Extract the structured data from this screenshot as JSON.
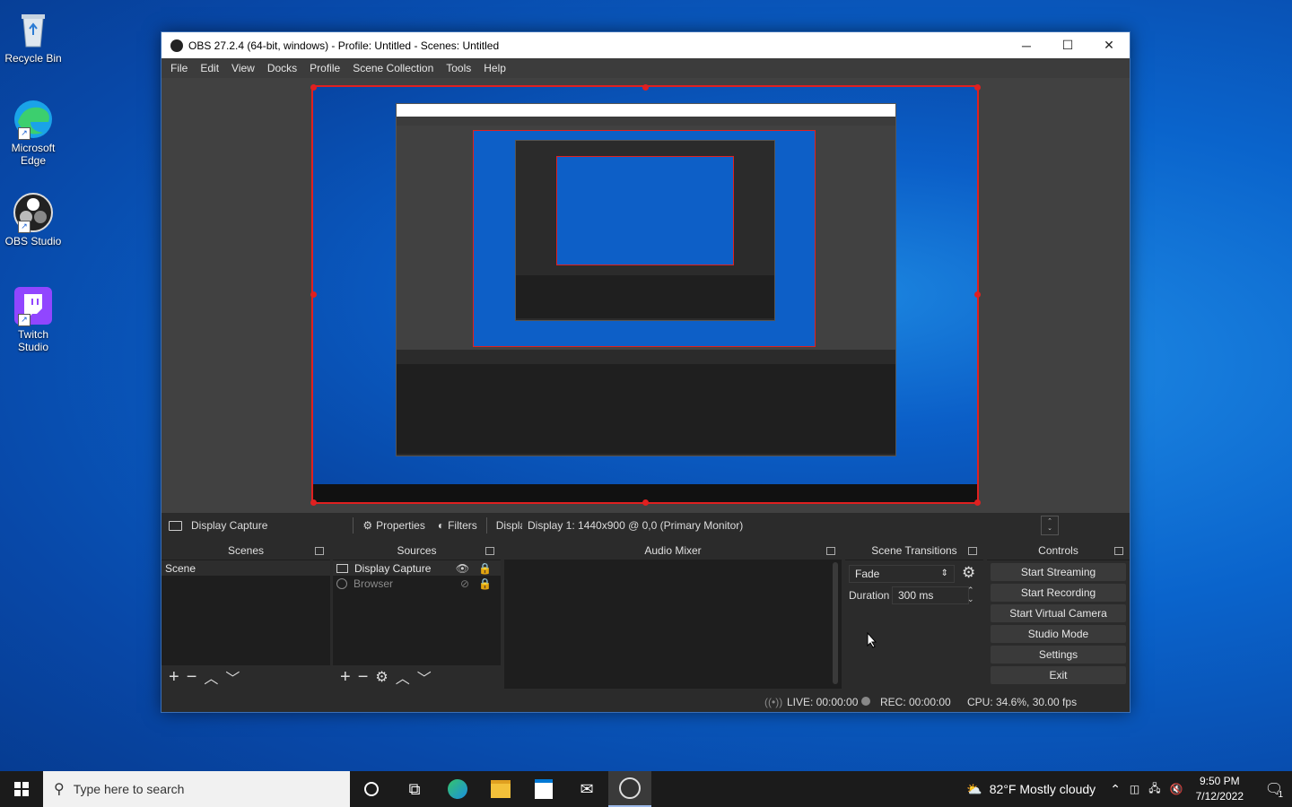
{
  "desktop": {
    "icons": [
      {
        "label": "Recycle Bin",
        "icon": "recycle-bin-icon"
      },
      {
        "label": "Microsoft Edge",
        "icon": "edge-icon"
      },
      {
        "label": "OBS Studio",
        "icon": "obs-icon"
      },
      {
        "label": "Twitch Studio",
        "icon": "twitch-icon"
      }
    ]
  },
  "window": {
    "title": "OBS 27.2.4 (64-bit, windows) - Profile: Untitled - Scenes: Untitled",
    "menu": [
      "File",
      "Edit",
      "View",
      "Docks",
      "Profile",
      "Scene Collection",
      "Tools",
      "Help"
    ]
  },
  "source_toolbar": {
    "source_name": "Display Capture",
    "properties": "Properties",
    "filters": "Filters",
    "display_label": "Display",
    "display_value": "Display 1: 1440x900 @ 0,0 (Primary Monitor)"
  },
  "docks": {
    "scenes": {
      "title": "Scenes",
      "items": [
        "Scene"
      ]
    },
    "sources": {
      "title": "Sources",
      "items": [
        {
          "name": "Display Capture",
          "visible": true
        },
        {
          "name": "Browser",
          "visible": false
        }
      ]
    },
    "audio_mixer": {
      "title": "Audio Mixer"
    },
    "transitions": {
      "title": "Scene Transitions",
      "transition": "Fade",
      "duration_label": "Duration",
      "duration_value": "300 ms"
    },
    "controls": {
      "title": "Controls",
      "buttons": [
        "Start Streaming",
        "Start Recording",
        "Start Virtual Camera",
        "Studio Mode",
        "Settings",
        "Exit"
      ]
    }
  },
  "status": {
    "live": "LIVE: 00:00:00",
    "rec": "REC: 00:00:00",
    "cpu": "CPU: 34.6%, 30.00 fps"
  },
  "taskbar": {
    "search_placeholder": "Type here to search",
    "weather": "82°F  Mostly cloudy",
    "time": "9:50 PM",
    "date": "7/12/2022",
    "notifications": "1"
  },
  "colors": {
    "accent": "#e02020",
    "obs_bg": "#2b2b2b",
    "taskbar": "#1b1b1b"
  }
}
